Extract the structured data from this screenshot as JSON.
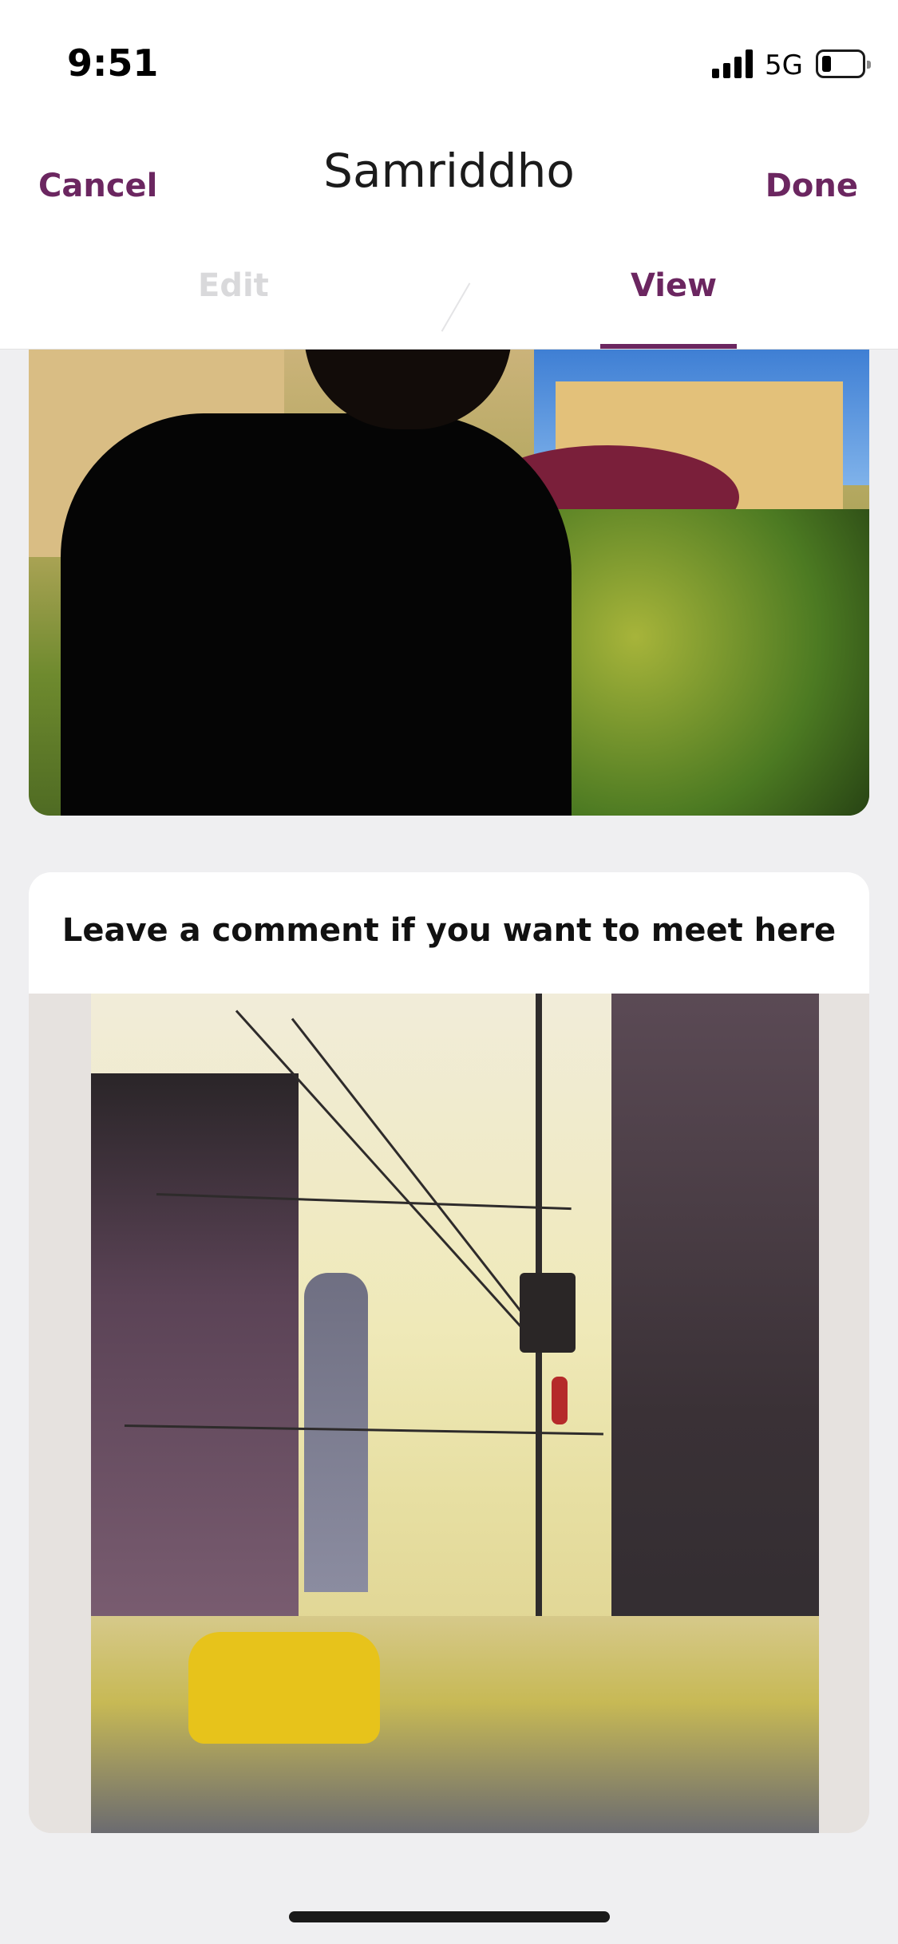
{
  "status_bar": {
    "time": "9:51",
    "network": "5G"
  },
  "nav": {
    "cancel_label": "Cancel",
    "title": "Samriddho",
    "done_label": "Done"
  },
  "tabs": {
    "edit_label": "Edit",
    "view_label": "View",
    "active": "View"
  },
  "comment_card": {
    "text": "Leave a comment if you want to meet here"
  },
  "colors": {
    "accent": "#6b2660",
    "inactive_tab": "#d9d9db",
    "background": "#efeff1"
  }
}
